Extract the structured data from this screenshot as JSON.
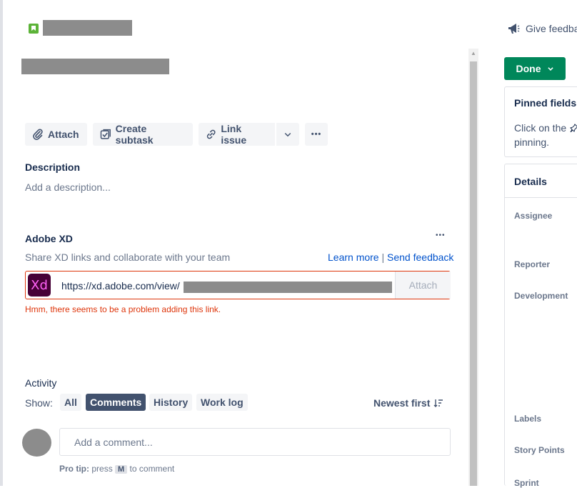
{
  "header": {
    "feedback_label": "Give feedba"
  },
  "toolbar": {
    "attach_label": "Attach",
    "subtask_label": "Create subtask",
    "link_label": "Link issue",
    "more_label": "•••"
  },
  "description": {
    "label": "Description",
    "placeholder": "Add a description..."
  },
  "adobe_xd": {
    "title": "Adobe XD",
    "more": "•••",
    "subtitle": "Share XD links and collaborate with your team",
    "learn_more": "Learn more",
    "separator": "|",
    "send_feedback": "Send feedback",
    "logo_text": "Xd",
    "url_value": "https://xd.adobe.com/view/",
    "attach_label": "Attach",
    "error": "Hmm, there seems to be a problem adding this link."
  },
  "activity": {
    "title": "Activity",
    "show_label": "Show:",
    "filters": [
      "All",
      "Comments",
      "History",
      "Work log"
    ],
    "active_filter": "Comments",
    "sort_label": "Newest first",
    "comment_placeholder": "Add a comment...",
    "protip_bold": "Pro tip:",
    "protip_press": "press",
    "protip_key": "M",
    "protip_rest": "to comment"
  },
  "sidebar": {
    "done_label": "Done",
    "pinned_title": "Pinned fields",
    "pinned_text_1": "Click on the",
    "pinned_text_2": "pinning.",
    "details_title": "Details",
    "fields": [
      "Assignee",
      "Reporter",
      "Development",
      "Labels",
      "Story Points",
      "Sprint"
    ]
  },
  "colors": {
    "accent": "#0052cc",
    "done": "#00875a",
    "error": "#de350b",
    "xd_logo_bg": "#470137",
    "xd_logo_fg": "#ff61f6"
  }
}
